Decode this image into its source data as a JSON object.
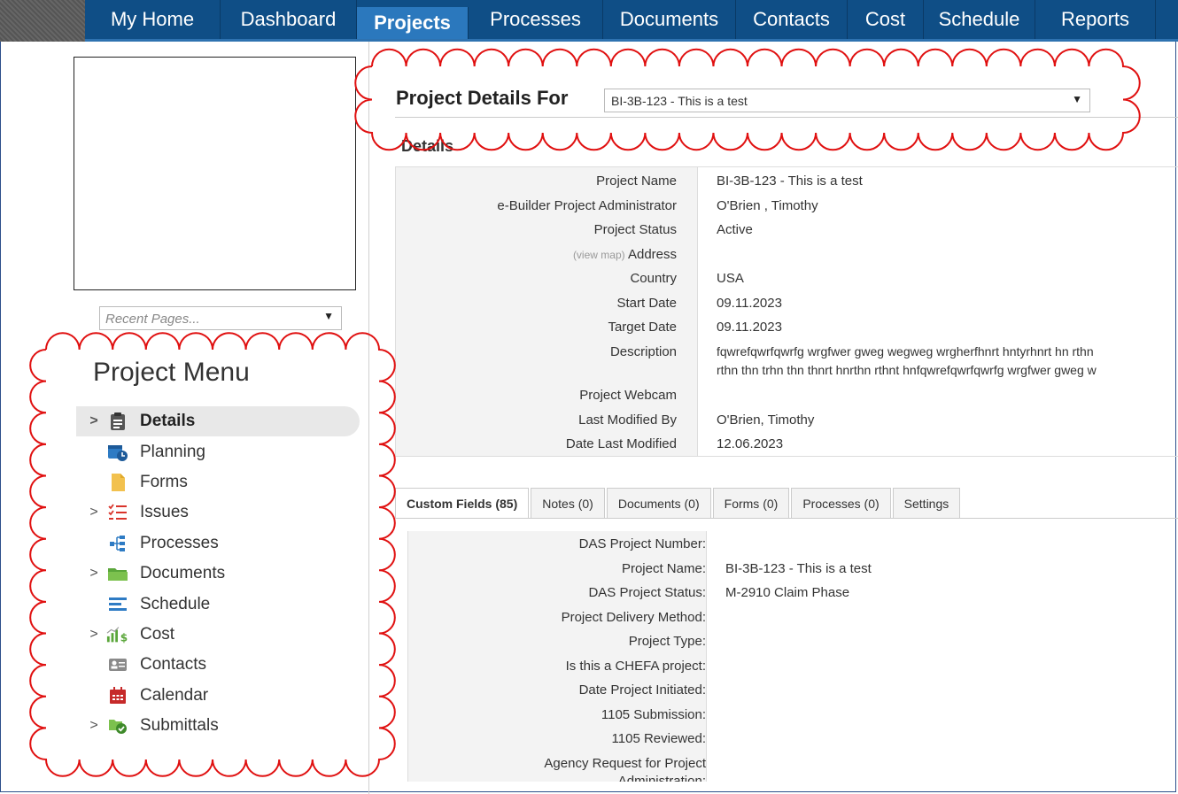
{
  "nav": {
    "items": [
      {
        "label": "My Home",
        "width": 153
      },
      {
        "label": "Dashboard",
        "width": 154
      },
      {
        "label": "Projects",
        "width": 126,
        "active": true
      },
      {
        "label": "Processes",
        "width": 152
      },
      {
        "label": "Documents",
        "width": 150
      },
      {
        "label": "Contacts",
        "width": 126
      },
      {
        "label": "Cost",
        "width": 86
      },
      {
        "label": "Schedule",
        "width": 126
      },
      {
        "label": "Reports",
        "width": 136
      }
    ]
  },
  "sidebar": {
    "recent_placeholder": "Recent Pages...",
    "menu_title": "Project Menu",
    "items": [
      {
        "label": "Details",
        "icon": "clipboard-icon",
        "expandable": true,
        "active": true
      },
      {
        "label": "Planning",
        "icon": "calendar-clock-icon",
        "expandable": false
      },
      {
        "label": "Forms",
        "icon": "form-document-icon",
        "expandable": false
      },
      {
        "label": "Issues",
        "icon": "checklist-icon",
        "expandable": true
      },
      {
        "label": "Processes",
        "icon": "process-tree-icon",
        "expandable": false
      },
      {
        "label": "Documents",
        "icon": "folder-icon",
        "expandable": true
      },
      {
        "label": "Schedule",
        "icon": "schedule-bars-icon",
        "expandable": false
      },
      {
        "label": "Cost",
        "icon": "cost-chart-icon",
        "expandable": true
      },
      {
        "label": "Contacts",
        "icon": "contact-card-icon",
        "expandable": false
      },
      {
        "label": "Calendar",
        "icon": "calendar-icon",
        "expandable": false
      },
      {
        "label": "Submittals",
        "icon": "submittal-check-icon",
        "expandable": true
      }
    ]
  },
  "header": {
    "title": "Project Details For",
    "project_select": "BI-3B-123 - This is a test"
  },
  "details": {
    "heading": "Details",
    "view_map": "(view map)",
    "rows": [
      {
        "label": "Project Name",
        "value": "BI-3B-123 - This is a test"
      },
      {
        "label": "e-Builder Project Administrator",
        "value": "O'Brien , Timothy"
      },
      {
        "label": "Project Status",
        "value": "Active"
      },
      {
        "label": "Address",
        "value": ""
      },
      {
        "label": "Country",
        "value": "USA"
      },
      {
        "label": "Start Date",
        "value": "09.11.2023"
      },
      {
        "label": "Target Date",
        "value": "09.11.2023"
      },
      {
        "label": "Description",
        "value": "fqwrefqwrfqwrfg wrgfwer gweg wegweg wrgherfhnrt hntyrhnrt hn rthn",
        "value2": "rthn thn trhn thn thnrt hnrthn rthnt hnfqwrefqwrfqwrfg wrgfwer gweg w"
      },
      {
        "label": "Project Webcam",
        "value": ""
      },
      {
        "label": "Last Modified By",
        "value": "O'Brien, Timothy"
      },
      {
        "label": "Date Last Modified",
        "value": "12.06.2023"
      }
    ]
  },
  "tabs": [
    {
      "label": "Custom Fields (85)",
      "active": true
    },
    {
      "label": "Notes (0)"
    },
    {
      "label": "Documents (0)"
    },
    {
      "label": "Forms (0)"
    },
    {
      "label": "Processes (0)"
    },
    {
      "label": "Settings"
    }
  ],
  "custom_fields": [
    {
      "label": "DAS Project Number:",
      "value": ""
    },
    {
      "label": "Project Name:",
      "value": "BI-3B-123 - This is a test"
    },
    {
      "label": "DAS Project Status:",
      "value": "M-2910 Claim Phase"
    },
    {
      "label": "Project Delivery Method:",
      "value": ""
    },
    {
      "label": "Project Type:",
      "value": ""
    },
    {
      "label": "Is this a CHEFA project:",
      "value": ""
    },
    {
      "label": "Date Project Initiated:",
      "value": ""
    },
    {
      "label": "1105 Submission:",
      "value": ""
    },
    {
      "label": "1105 Reviewed:",
      "value": ""
    },
    {
      "label": "Agency Request for Project",
      "value": ""
    },
    {
      "label": "Administration:",
      "value": ""
    }
  ],
  "colors": {
    "nav_bg": "#0f4e86",
    "nav_active": "#2b78bd",
    "annotation": "#e01010"
  }
}
